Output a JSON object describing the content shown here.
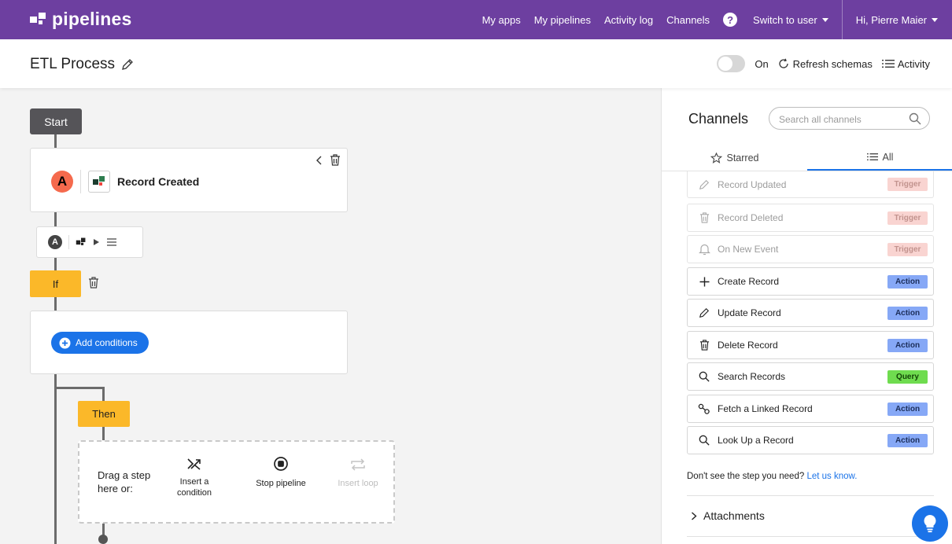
{
  "brand": {
    "name": "pipelines"
  },
  "nav": {
    "my_apps": "My apps",
    "my_pipelines": "My pipelines",
    "activity_log": "Activity log",
    "channels": "Channels",
    "help": "?",
    "switch_user": "Switch to user",
    "greeting": "Hi, Pierre Maier"
  },
  "header": {
    "title": "ETL Process",
    "toggle_label": "On",
    "refresh": "Refresh schemas",
    "activity": "Activity"
  },
  "canvas": {
    "start": "Start",
    "trigger_avatar": "A",
    "trigger_title": "Record Created",
    "mini_avatar": "A",
    "if_label": "If",
    "add_conditions": "Add conditions",
    "then_label": "Then",
    "drag_text": "Drag a step here or:",
    "insert_condition": "Insert a condition",
    "stop_pipeline": "Stop pipeline",
    "insert_loop": "Insert loop"
  },
  "panel": {
    "title": "Channels",
    "search_placeholder": "Search all channels",
    "tab_starred": "Starred",
    "tab_all": "All",
    "items": [
      {
        "label": "Record Updated",
        "badge": "Trigger",
        "icon": "pencil-icon"
      },
      {
        "label": "Record Deleted",
        "badge": "Trigger",
        "icon": "trash-icon"
      },
      {
        "label": "On New Event",
        "badge": "Trigger",
        "icon": "bell-icon"
      },
      {
        "label": "Create Record",
        "badge": "Action",
        "icon": "plus-icon"
      },
      {
        "label": "Update Record",
        "badge": "Action",
        "icon": "pencil-icon"
      },
      {
        "label": "Delete Record",
        "badge": "Action",
        "icon": "trash-icon"
      },
      {
        "label": "Search Records",
        "badge": "Query",
        "icon": "search-icon"
      },
      {
        "label": "Fetch a Linked Record",
        "badge": "Action",
        "icon": "link-icon"
      },
      {
        "label": "Look Up a Record",
        "badge": "Action",
        "icon": "search-icon"
      }
    ],
    "note_text": "Don't see the step you need?",
    "note_link": "Let us know.",
    "attachments": "Attachments"
  },
  "colors": {
    "topbar": "#6d3fa0",
    "accent": "#1b73e8",
    "condition": "#fbb829",
    "trigger_badge": "#f9d4d1",
    "action_badge": "#86a8f6",
    "query_badge": "#6fdc4f"
  }
}
